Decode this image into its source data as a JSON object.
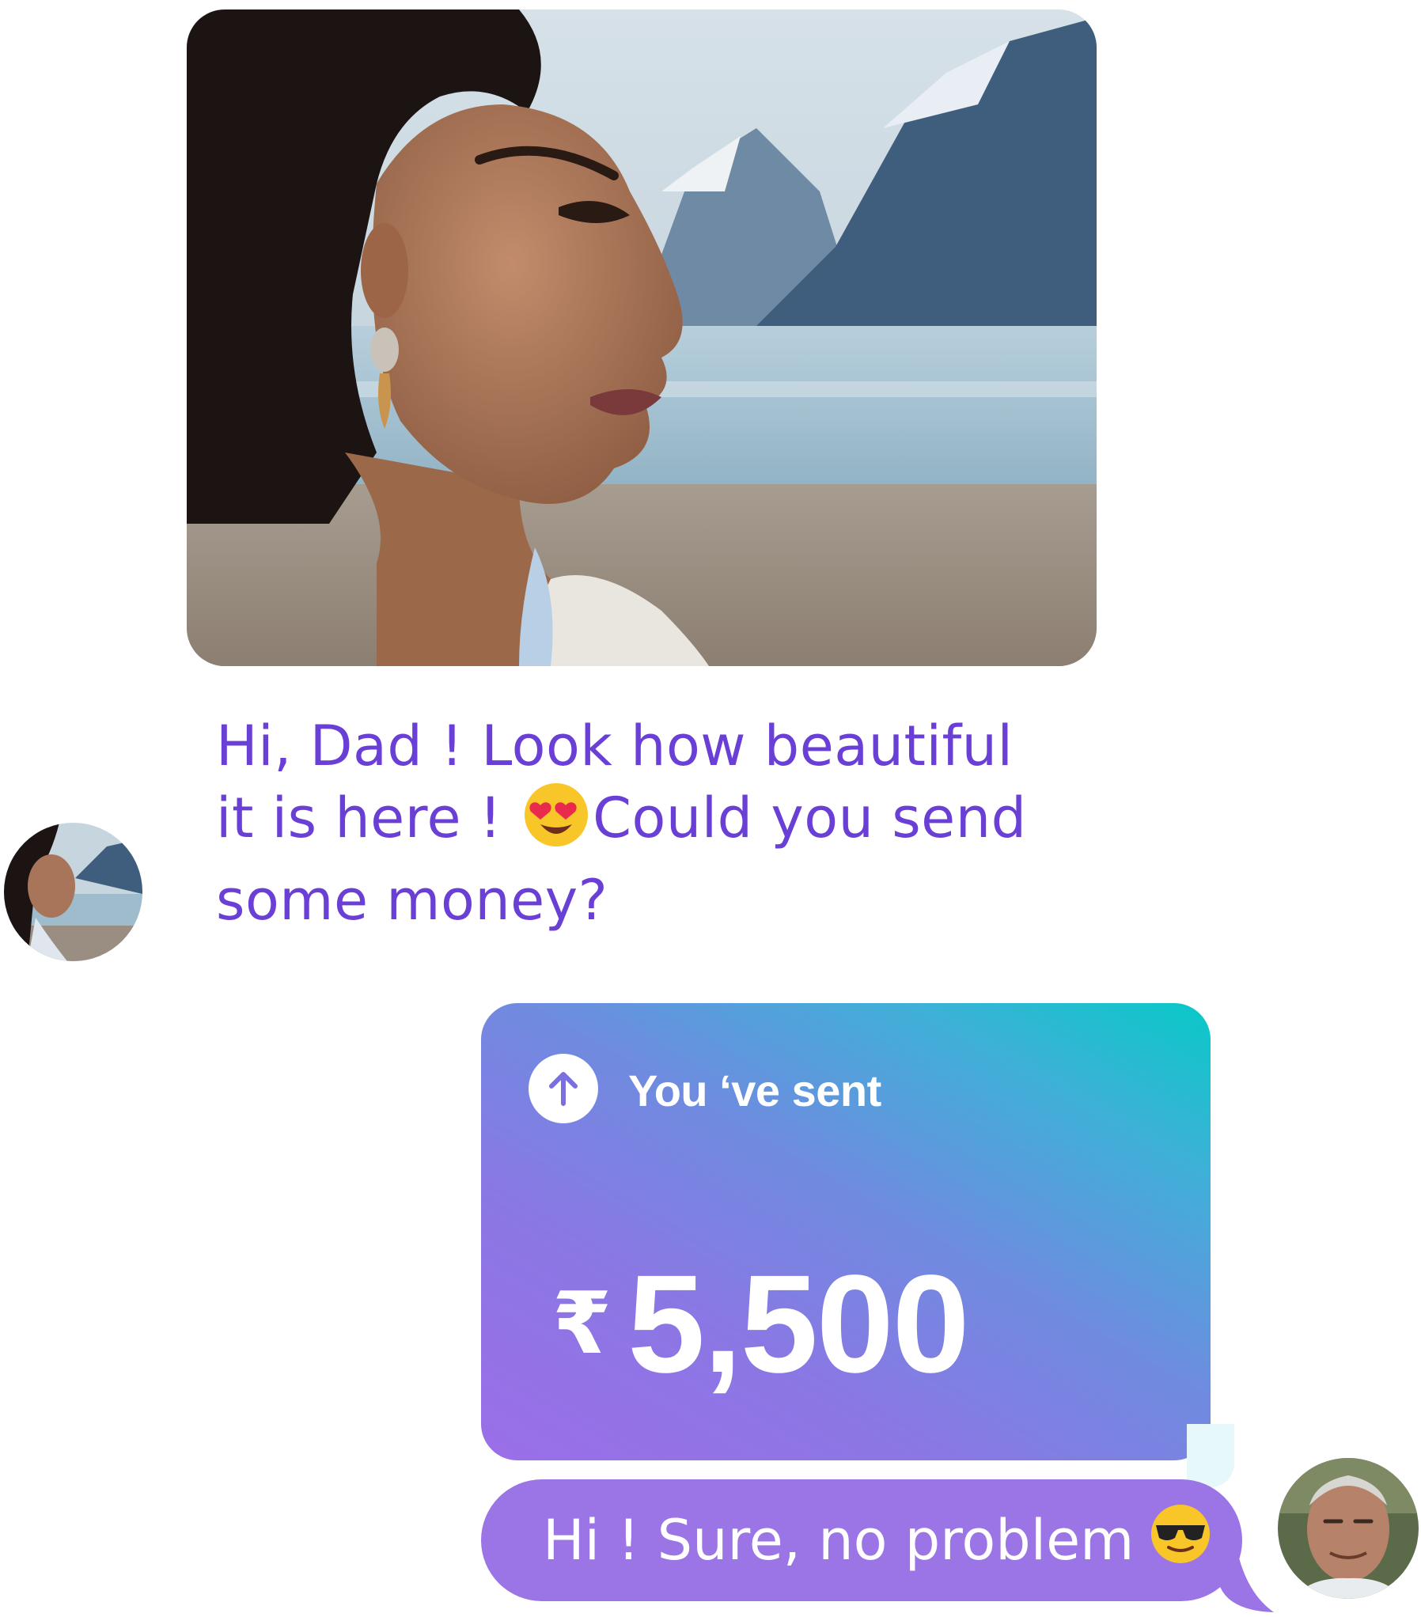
{
  "incoming_message": {
    "text_part1": "Hi, Dad ! Look how beautiful it is here ! ",
    "emoji": "heart-eyes-emoji",
    "text_part2": "Could you send some money?"
  },
  "payment": {
    "label": "You ‘ve sent",
    "currency_symbol": "₹",
    "amount": "5,500",
    "direction_icon": "arrow-up-icon"
  },
  "reply": {
    "text": "Hi ! Sure, no problem",
    "emoji": "sunglasses-emoji"
  },
  "colors": {
    "incoming_text": "#6a3fd6",
    "card_gradient_start": "#9b6ee8",
    "card_gradient_end": "#08c9c7",
    "reply_bubble": "#9b74e6"
  }
}
